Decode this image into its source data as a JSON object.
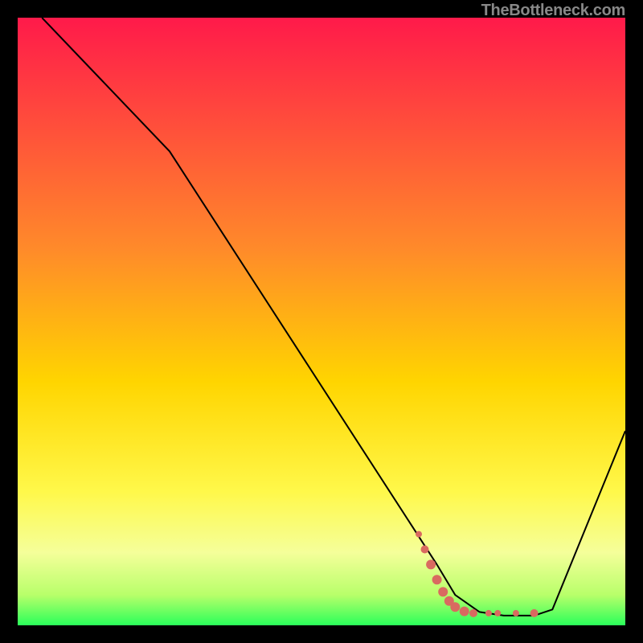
{
  "watermark": "TheBottleneck.com",
  "chart_data": {
    "type": "line",
    "title": "",
    "xlabel": "",
    "ylabel": "",
    "xlim": [
      0,
      100
    ],
    "ylim": [
      0,
      100
    ],
    "grid": false,
    "legend": "none",
    "gradient_stops": [
      {
        "offset": 0,
        "color": "#ff1a4a"
      },
      {
        "offset": 38,
        "color": "#ff8a2a"
      },
      {
        "offset": 60,
        "color": "#ffd500"
      },
      {
        "offset": 78,
        "color": "#fff84a"
      },
      {
        "offset": 88,
        "color": "#f5ff9a"
      },
      {
        "offset": 95,
        "color": "#b8ff6a"
      },
      {
        "offset": 100,
        "color": "#2aff5a"
      }
    ],
    "series": [
      {
        "name": "bottleneck-curve",
        "stroke": "#000000",
        "stroke_width": 2,
        "points": [
          {
            "x": 4,
            "y": 100
          },
          {
            "x": 25,
            "y": 78
          },
          {
            "x": 69,
            "y": 10
          },
          {
            "x": 72,
            "y": 5
          },
          {
            "x": 76,
            "y": 2.2
          },
          {
            "x": 80,
            "y": 1.6
          },
          {
            "x": 85,
            "y": 1.6
          },
          {
            "x": 88,
            "y": 2.6
          },
          {
            "x": 100,
            "y": 32
          }
        ]
      }
    ],
    "highlight_marks": {
      "color": "#d96a60",
      "points": [
        {
          "x": 66,
          "y": 15,
          "r": 4
        },
        {
          "x": 67,
          "y": 12.5,
          "r": 5
        },
        {
          "x": 68,
          "y": 10,
          "r": 6
        },
        {
          "x": 69,
          "y": 7.5,
          "r": 6
        },
        {
          "x": 70,
          "y": 5.5,
          "r": 6
        },
        {
          "x": 71,
          "y": 4,
          "r": 6
        },
        {
          "x": 72,
          "y": 3,
          "r": 6
        },
        {
          "x": 73.5,
          "y": 2.3,
          "r": 6
        },
        {
          "x": 75,
          "y": 2,
          "r": 5
        },
        {
          "x": 77.5,
          "y": 2,
          "r": 4
        },
        {
          "x": 79,
          "y": 2,
          "r": 4
        },
        {
          "x": 82,
          "y": 2,
          "r": 4
        },
        {
          "x": 85,
          "y": 2,
          "r": 5
        }
      ]
    }
  }
}
